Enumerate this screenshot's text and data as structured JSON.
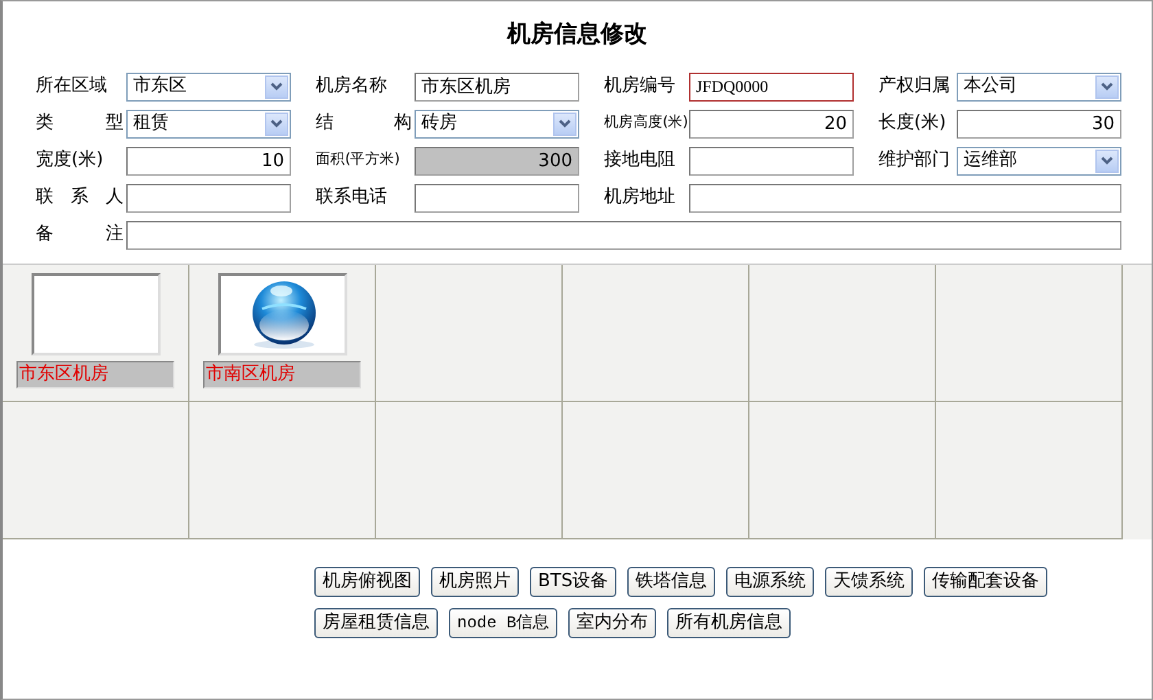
{
  "title": "机房信息修改",
  "rows": [
    [
      {
        "label": "所在区域",
        "kind": "select",
        "value": "市东区"
      },
      {
        "label": "机房名称",
        "kind": "input",
        "value": "市东区机房"
      },
      {
        "label": "机房编号",
        "kind": "input",
        "value": "JFDQ0000",
        "focused": true
      },
      {
        "label": "产权归属",
        "kind": "select",
        "value": "本公司"
      }
    ],
    [
      {
        "label": "类 型",
        "kind": "select",
        "value": "租赁"
      },
      {
        "label": "结 构",
        "kind": "select",
        "value": "砖房"
      },
      {
        "label": "机房高度(米)",
        "kind": "input",
        "value": "20",
        "numeric": true
      },
      {
        "label": "长度(米)",
        "kind": "input",
        "value": "30",
        "numeric": true
      }
    ],
    [
      {
        "label": "宽度(米)",
        "kind": "input",
        "value": "10",
        "numeric": true
      },
      {
        "label": "面积(平方米)",
        "kind": "input",
        "value": "300",
        "numeric": true,
        "readonly": true
      },
      {
        "label": "接地电阻",
        "kind": "input"
      },
      {
        "label": "维护部门",
        "kind": "select",
        "value": "运维部"
      }
    ],
    [
      {
        "label": "联 系 人",
        "kind": "input"
      },
      {
        "label": "联系电话",
        "kind": "input"
      },
      {
        "label": "机房地址",
        "kind": "input",
        "wide": true
      }
    ],
    [
      {
        "label": "备 注",
        "kind": "input",
        "wide": true
      }
    ]
  ],
  "rooms": [
    {
      "name": "市东区机房",
      "kind": "blank"
    },
    {
      "name": "市南区机房",
      "kind": "picture"
    }
  ],
  "buttons": [
    [
      "机房俯视图",
      "机房照片",
      "BTS设备",
      "铁塔信息",
      "电源系统",
      "天馈系统",
      "传输配套设备"
    ],
    [
      "房屋租赁信息",
      "node B信息",
      "室内分布",
      "所有机房信息"
    ]
  ]
}
